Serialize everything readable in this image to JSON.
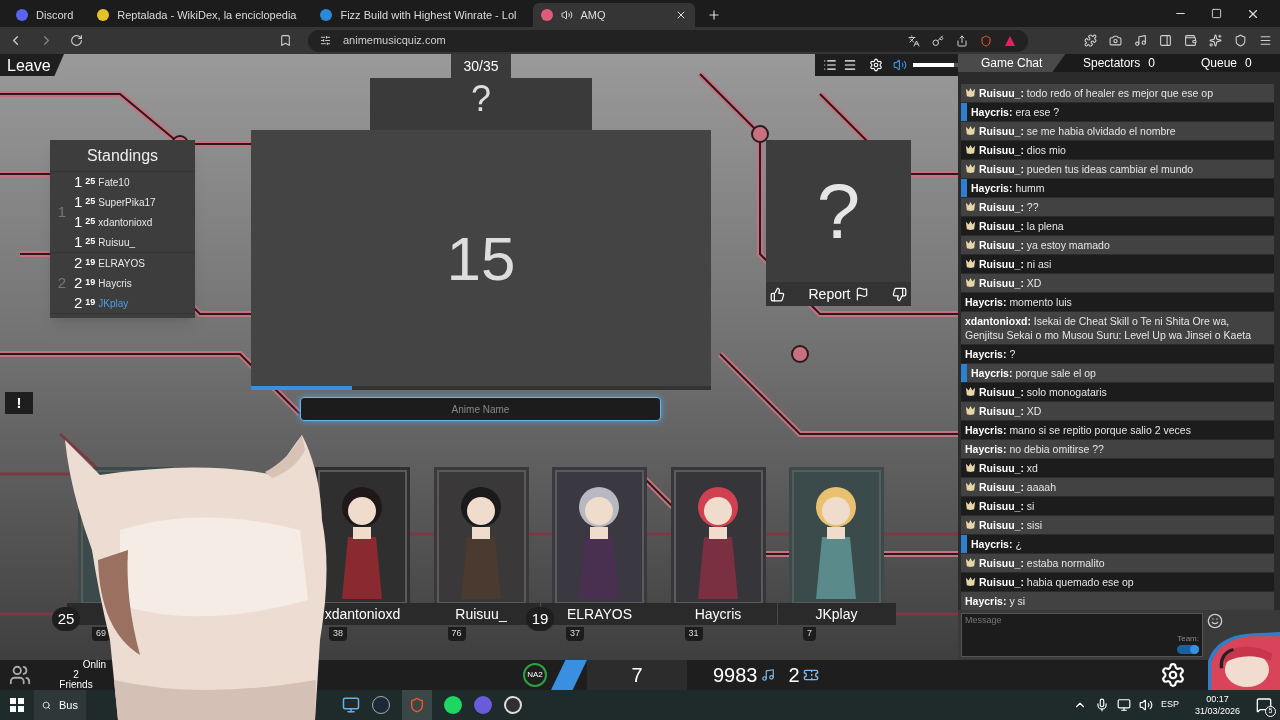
{
  "browser": {
    "tabs": [
      {
        "title": "Discord",
        "kind": "chat",
        "playing": false,
        "selected": false
      },
      {
        "title": "Reptalada - WikiDex, la enciclopedia",
        "kind": "wiki",
        "playing": false,
        "selected": false
      },
      {
        "title": "Fizz Build with Highest Winrate - Lol",
        "kind": "game",
        "playing": false,
        "selected": false
      },
      {
        "title": "AMQ",
        "kind": "quiz",
        "playing": true,
        "selected": true
      }
    ],
    "url": "animemusicquiz.com"
  },
  "game": {
    "leave": "Leave",
    "counter": "30/35",
    "hidden_title": "?",
    "countdown": "15",
    "progress": {
      "level": 0.22
    },
    "answer": {
      "placeholder": "Anime Name"
    },
    "alert": "!",
    "volume": {
      "level": 0.9
    },
    "standings": {
      "title": "Standings",
      "groups": [
        {
          "rank": "1",
          "rows": [
            {
              "rank": "1",
              "score": "25",
              "name": "Fate10",
              "highlighted": false
            },
            {
              "rank": "1",
              "score": "25",
              "name": "SuperPika17",
              "highlighted": false
            },
            {
              "rank": "1",
              "score": "25",
              "name": "xdantonioxd",
              "highlighted": false
            },
            {
              "rank": "1",
              "score": "25",
              "name": "Ruisuu_",
              "highlighted": false
            }
          ]
        },
        {
          "rank": "2",
          "rows": [
            {
              "rank": "2",
              "score": "19",
              "name": "ELRAYOS",
              "highlighted": false
            },
            {
              "rank": "2",
              "score": "19",
              "name": "Haycris",
              "highlighted": false
            },
            {
              "rank": "2",
              "score": "19",
              "name": "JKplay",
              "highlighted": true
            }
          ]
        }
      ]
    },
    "song_info": {
      "mark": "?",
      "report": "Report"
    },
    "players": [
      {
        "score": "25",
        "level": "69"
      },
      {
        "name": "xdantonioxd",
        "level": "38"
      },
      {
        "name": "Ruisuu_",
        "level": "76"
      },
      {
        "score": "19",
        "name": "ELRAYOS",
        "level": "37"
      },
      {
        "name": "Haycris",
        "level": "31"
      },
      {
        "name": "JKplay",
        "level": "7"
      }
    ],
    "bottom_bar": {
      "online": "Onlin",
      "friends_count": "2",
      "friends": "Friends",
      "server": "NA2",
      "level": "7",
      "notes": "9983",
      "tickets": "2"
    }
  },
  "chat": {
    "tabs": [
      {
        "label": "Game Chat",
        "selected": true
      },
      {
        "label": "Spectators",
        "count": "0",
        "selected": false
      },
      {
        "label": "Queue",
        "count": "0",
        "selected": false
      }
    ],
    "messages": [
      {
        "name": "Ruisuu_:",
        "text": "todo redo of healer es mejor que ese op",
        "kind": "patron"
      },
      {
        "name": "Haycris:",
        "text": "era ese ?",
        "kind": "accent"
      },
      {
        "name": "Ruisuu_:",
        "text": "se me habia olvidado el nombre",
        "kind": "patron"
      },
      {
        "name": "Ruisuu_:",
        "text": "dios mio",
        "kind": "patron"
      },
      {
        "name": "Ruisuu_:",
        "text": "pueden tus ideas cambiar el mundo",
        "kind": "patron"
      },
      {
        "name": "Haycris:",
        "text": "humm",
        "kind": "accent"
      },
      {
        "name": "Ruisuu_:",
        "text": "??",
        "kind": "patron"
      },
      {
        "name": "Ruisuu_:",
        "text": "la plena",
        "kind": "patron"
      },
      {
        "name": "Ruisuu_:",
        "text": "ya estoy mamado",
        "kind": "patron"
      },
      {
        "name": "Ruisuu_:",
        "text": "ni asi",
        "kind": "patron"
      },
      {
        "name": "Ruisuu_:",
        "text": "XD",
        "kind": "patron"
      },
      {
        "name": "Haycris:",
        "text": "momento luis",
        "kind": "plain"
      },
      {
        "name": "xdantonioxd:",
        "text": "Isekai de Cheat Skill o Te ni Shita Ore wa, Genjitsu Sekai o mo Musou Suru: Level Up wa Jinsei o Kaeta",
        "kind": "plain"
      },
      {
        "name": "Haycris:",
        "text": "?",
        "kind": "plain"
      },
      {
        "name": "Haycris:",
        "text": "porque sale el op",
        "kind": "accent"
      },
      {
        "name": "Ruisuu_:",
        "text": "solo monogataris",
        "kind": "patron"
      },
      {
        "name": "Ruisuu_:",
        "text": "XD",
        "kind": "patron"
      },
      {
        "name": "Haycris:",
        "text": "mano si se repitio porque salio 2 veces",
        "kind": "plain"
      },
      {
        "name": "Haycris:",
        "text": "no debia omitirse ??",
        "kind": "plain"
      },
      {
        "name": "Ruisuu_:",
        "text": "xd",
        "kind": "patron"
      },
      {
        "name": "Ruisuu_:",
        "text": "aaaah",
        "kind": "patron"
      },
      {
        "name": "Ruisuu_:",
        "text": "si",
        "kind": "patron"
      },
      {
        "name": "Ruisuu_:",
        "text": "sisi",
        "kind": "patron"
      },
      {
        "name": "Haycris:",
        "text": "¿",
        "kind": "accent"
      },
      {
        "name": "Ruisuu_:",
        "text": "estaba normalito",
        "kind": "patron"
      },
      {
        "name": "Ruisuu_:",
        "text": "habia quemado ese op",
        "kind": "patron"
      },
      {
        "name": "Haycris:",
        "text": "y si",
        "kind": "plain"
      }
    ],
    "input": {
      "placeholder": "Message",
      "team_label": "Team:",
      "team_on": true
    }
  },
  "taskbar": {
    "search": "Bus",
    "language": "ESP",
    "time": "00:17",
    "date": "31/03/2026",
    "notifications": "5"
  }
}
